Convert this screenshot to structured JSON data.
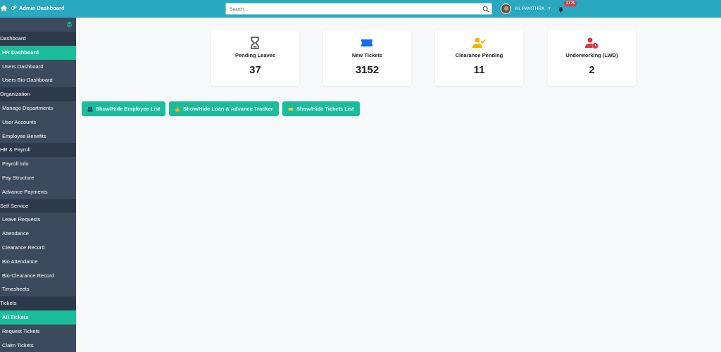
{
  "header": {
    "title": "Admin Dashboard",
    "search_placeholder": "Search...",
    "user_greeting": "Hi, PAVITHRA",
    "notification_count": "2176"
  },
  "sidebar": {
    "items": [
      {
        "label": "Dashboard",
        "type": "section"
      },
      {
        "label": "HR Dashboard",
        "type": "active"
      },
      {
        "label": "Users Dashboard",
        "type": "item"
      },
      {
        "label": "Users Bio-Dashboard",
        "type": "item"
      },
      {
        "label": "Organization",
        "type": "section"
      },
      {
        "label": "Manage Departments",
        "type": "item"
      },
      {
        "label": "User Accounts",
        "type": "item"
      },
      {
        "label": "Employee Benefits",
        "type": "item"
      },
      {
        "label": "HR & Payroll",
        "type": "section"
      },
      {
        "label": "Payroll Info",
        "type": "item"
      },
      {
        "label": "Pay Structure",
        "type": "item"
      },
      {
        "label": "Advance Payments",
        "type": "item"
      },
      {
        "label": "Self Service",
        "type": "section"
      },
      {
        "label": "Leave Requests",
        "type": "item"
      },
      {
        "label": "Attendance",
        "type": "item"
      },
      {
        "label": "Clearance Record",
        "type": "item"
      },
      {
        "label": "Bio Attendance",
        "type": "item"
      },
      {
        "label": "Bio-Clearance Record",
        "type": "item"
      },
      {
        "label": "Timesheets",
        "type": "item"
      },
      {
        "label": "Tickets",
        "type": "section"
      },
      {
        "label": "All Tickets",
        "type": "active"
      },
      {
        "label": "Request Tickets",
        "type": "item"
      },
      {
        "label": "Claim Tickets",
        "type": "item"
      }
    ]
  },
  "cards": [
    {
      "label": "Pending Leaves",
      "value": "37",
      "icon": "hourglass-icon",
      "color": "#555555"
    },
    {
      "label": "New Tickets",
      "value": "3152",
      "icon": "ticket-icon",
      "color": "#0d6efd"
    },
    {
      "label": "Clearance Pending",
      "value": "11",
      "icon": "user-check-icon",
      "color": "#f5b400"
    },
    {
      "label": "Underworking (LWD)",
      "value": "2",
      "icon": "user-clock-icon",
      "color": "#dc3545"
    }
  ],
  "buttons": [
    {
      "label": "Show/Hide Employee List",
      "icon": "users-icon"
    },
    {
      "label": "Show/Hide Loan & Advance Tracker",
      "icon": "money-bag-icon"
    },
    {
      "label": "Show/Hide Tickets List",
      "icon": "ticket-icon"
    }
  ],
  "colors": {
    "topbar": "#2aa8c0",
    "sidebar": "#3b4a5c",
    "sidebar_section": "#2c3a4b",
    "accent": "#1abc9c",
    "badge": "#dc3545"
  }
}
